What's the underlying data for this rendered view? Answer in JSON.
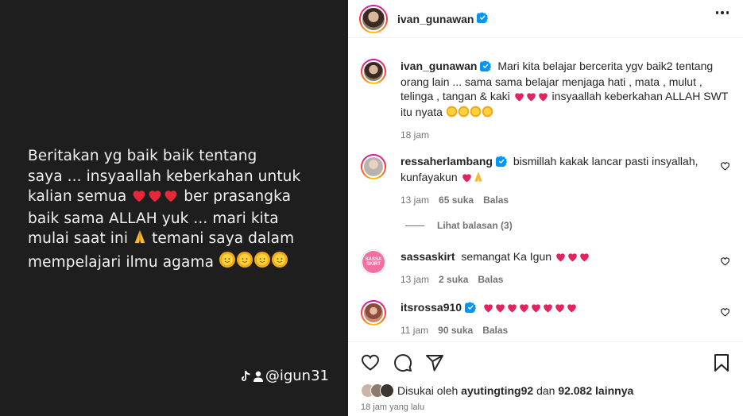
{
  "media": {
    "lines": [
      "Beritakan  yg  baik baik  tentang",
      "saya  ... insyaallah keberkahan untuk",
      "kalian  semua",
      "ber prasangka",
      "baik  sama  ALLAH  yuk  ... mari  kita",
      "mulai  saat  ini",
      "temani saya  dalam",
      "mempelajari  ilmu  agama"
    ],
    "watermark": "@igun31"
  },
  "header": {
    "username": "ivan_gunawan",
    "more_label": "..."
  },
  "caption": {
    "username": "ivan_gunawan",
    "text_part1": "Mari kita belajar bercerita ygv baik2 tentang orang lain ... sama sama belajar menjaga hati , mata , mulut , telinga , tangan & kaki",
    "text_part2": "insyaallah keberkahan ALLAH SWT itu nyata",
    "time": "18 jam"
  },
  "comments": [
    {
      "username": "ressaherlambang",
      "text": "bismillah kakak lancar pasti insyallah, kunfayakun",
      "time": "13 jam",
      "likes": "65 suka",
      "reply": "Balas"
    },
    {
      "username": "sassaskirt",
      "text": "semangat Ka Igun",
      "time": "13 jam",
      "likes": "2 suka",
      "reply": "Balas"
    },
    {
      "username": "itsrossa910",
      "text": "",
      "time": "11 jam",
      "likes": "90 suka",
      "reply": "Balas"
    }
  ],
  "view_replies": "Lihat balasan (3)",
  "likes": {
    "prefix": "Disukai oleh",
    "user": "ayutingting92",
    "middle": "dan",
    "count": "92.082 lainnya"
  },
  "post_time": "18 jam yang lalu",
  "icons": {
    "verified": "verified-badge-icon",
    "heart": "heart-icon",
    "comment": "comment-icon",
    "share": "share-icon",
    "save": "bookmark-icon"
  },
  "colors": {
    "verified": "#0095f6",
    "heart_red": "#e0245e",
    "muted": "#737373"
  }
}
